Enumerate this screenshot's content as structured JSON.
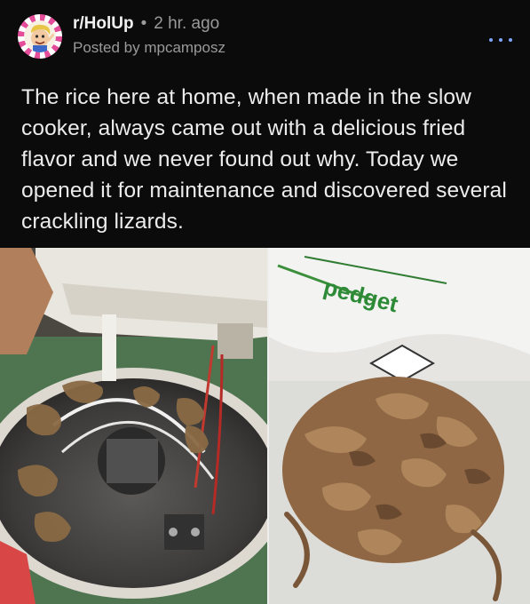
{
  "post": {
    "subreddit": "r/HolUp",
    "separator": "•",
    "time_ago": "2 hr. ago",
    "posted_by": "Posted by mpcamposz",
    "title": "The rice here at home, when made in the slow cooker, always came out with a delicious fried flavor and we never found out why. Today we opened it for maintenance and discovered several crackling lizards."
  },
  "bag_print": "pedget",
  "colors": {
    "background": "#0b0b0b",
    "text": "#ececec",
    "meta": "#9a9a9a",
    "more_dots": "#7ea6ff",
    "avatar_ring": "#e44d9a"
  },
  "icons": {
    "avatar": "holup-avatar-icon",
    "more": "more-options-icon"
  }
}
